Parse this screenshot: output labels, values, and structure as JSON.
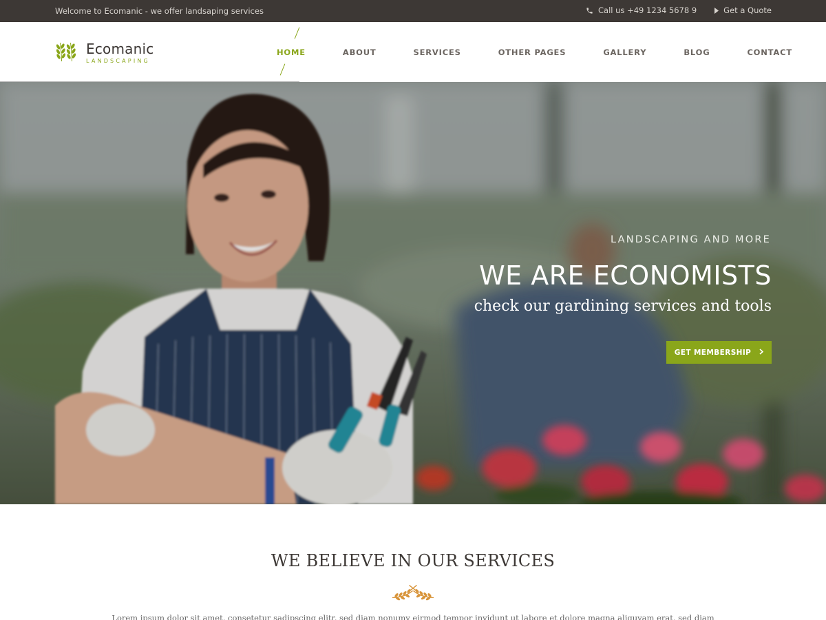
{
  "topbar": {
    "welcome": "Welcome to Ecomanic - we offer landsaping services",
    "phone": "Call us +49 1234 5678 9",
    "phone_icon": "phone-icon",
    "quote": "Get a Quote",
    "quote_icon": "caret-right-icon"
  },
  "header": {
    "logo_name": "Ecomanic",
    "logo_sub": "LANDSCAPING",
    "logo_icon": "wheat-icon",
    "nav": [
      "HOME",
      "ABOUT",
      "SERVICES",
      "OTHER PAGES",
      "GALLERY",
      "BLOG",
      "CONTACT"
    ],
    "active_nav": "HOME"
  },
  "hero": {
    "tagline": "LANDSCAPING AND MORE",
    "headline": "WE ARE ECONOMISTS",
    "subline": "check our gardining services and tools",
    "cta_label": "GET MEMBERSHIP",
    "cta_icon": "chevron-right-icon"
  },
  "services": {
    "title": "WE BELIEVE IN OUR SERVICES",
    "ornament_icon": "wheat-ornament-icon",
    "lorem": "Lorem ipsum dolor sit amet, consetetur sadipscing elitr, sed diam nonumy eirmod tempor invidunt ut labore et dolore magna aliquyam erat, sed diam"
  },
  "colors": {
    "accent": "#8aa61a",
    "topbar_bg": "#3d3835",
    "ornament": "#d8943a"
  }
}
